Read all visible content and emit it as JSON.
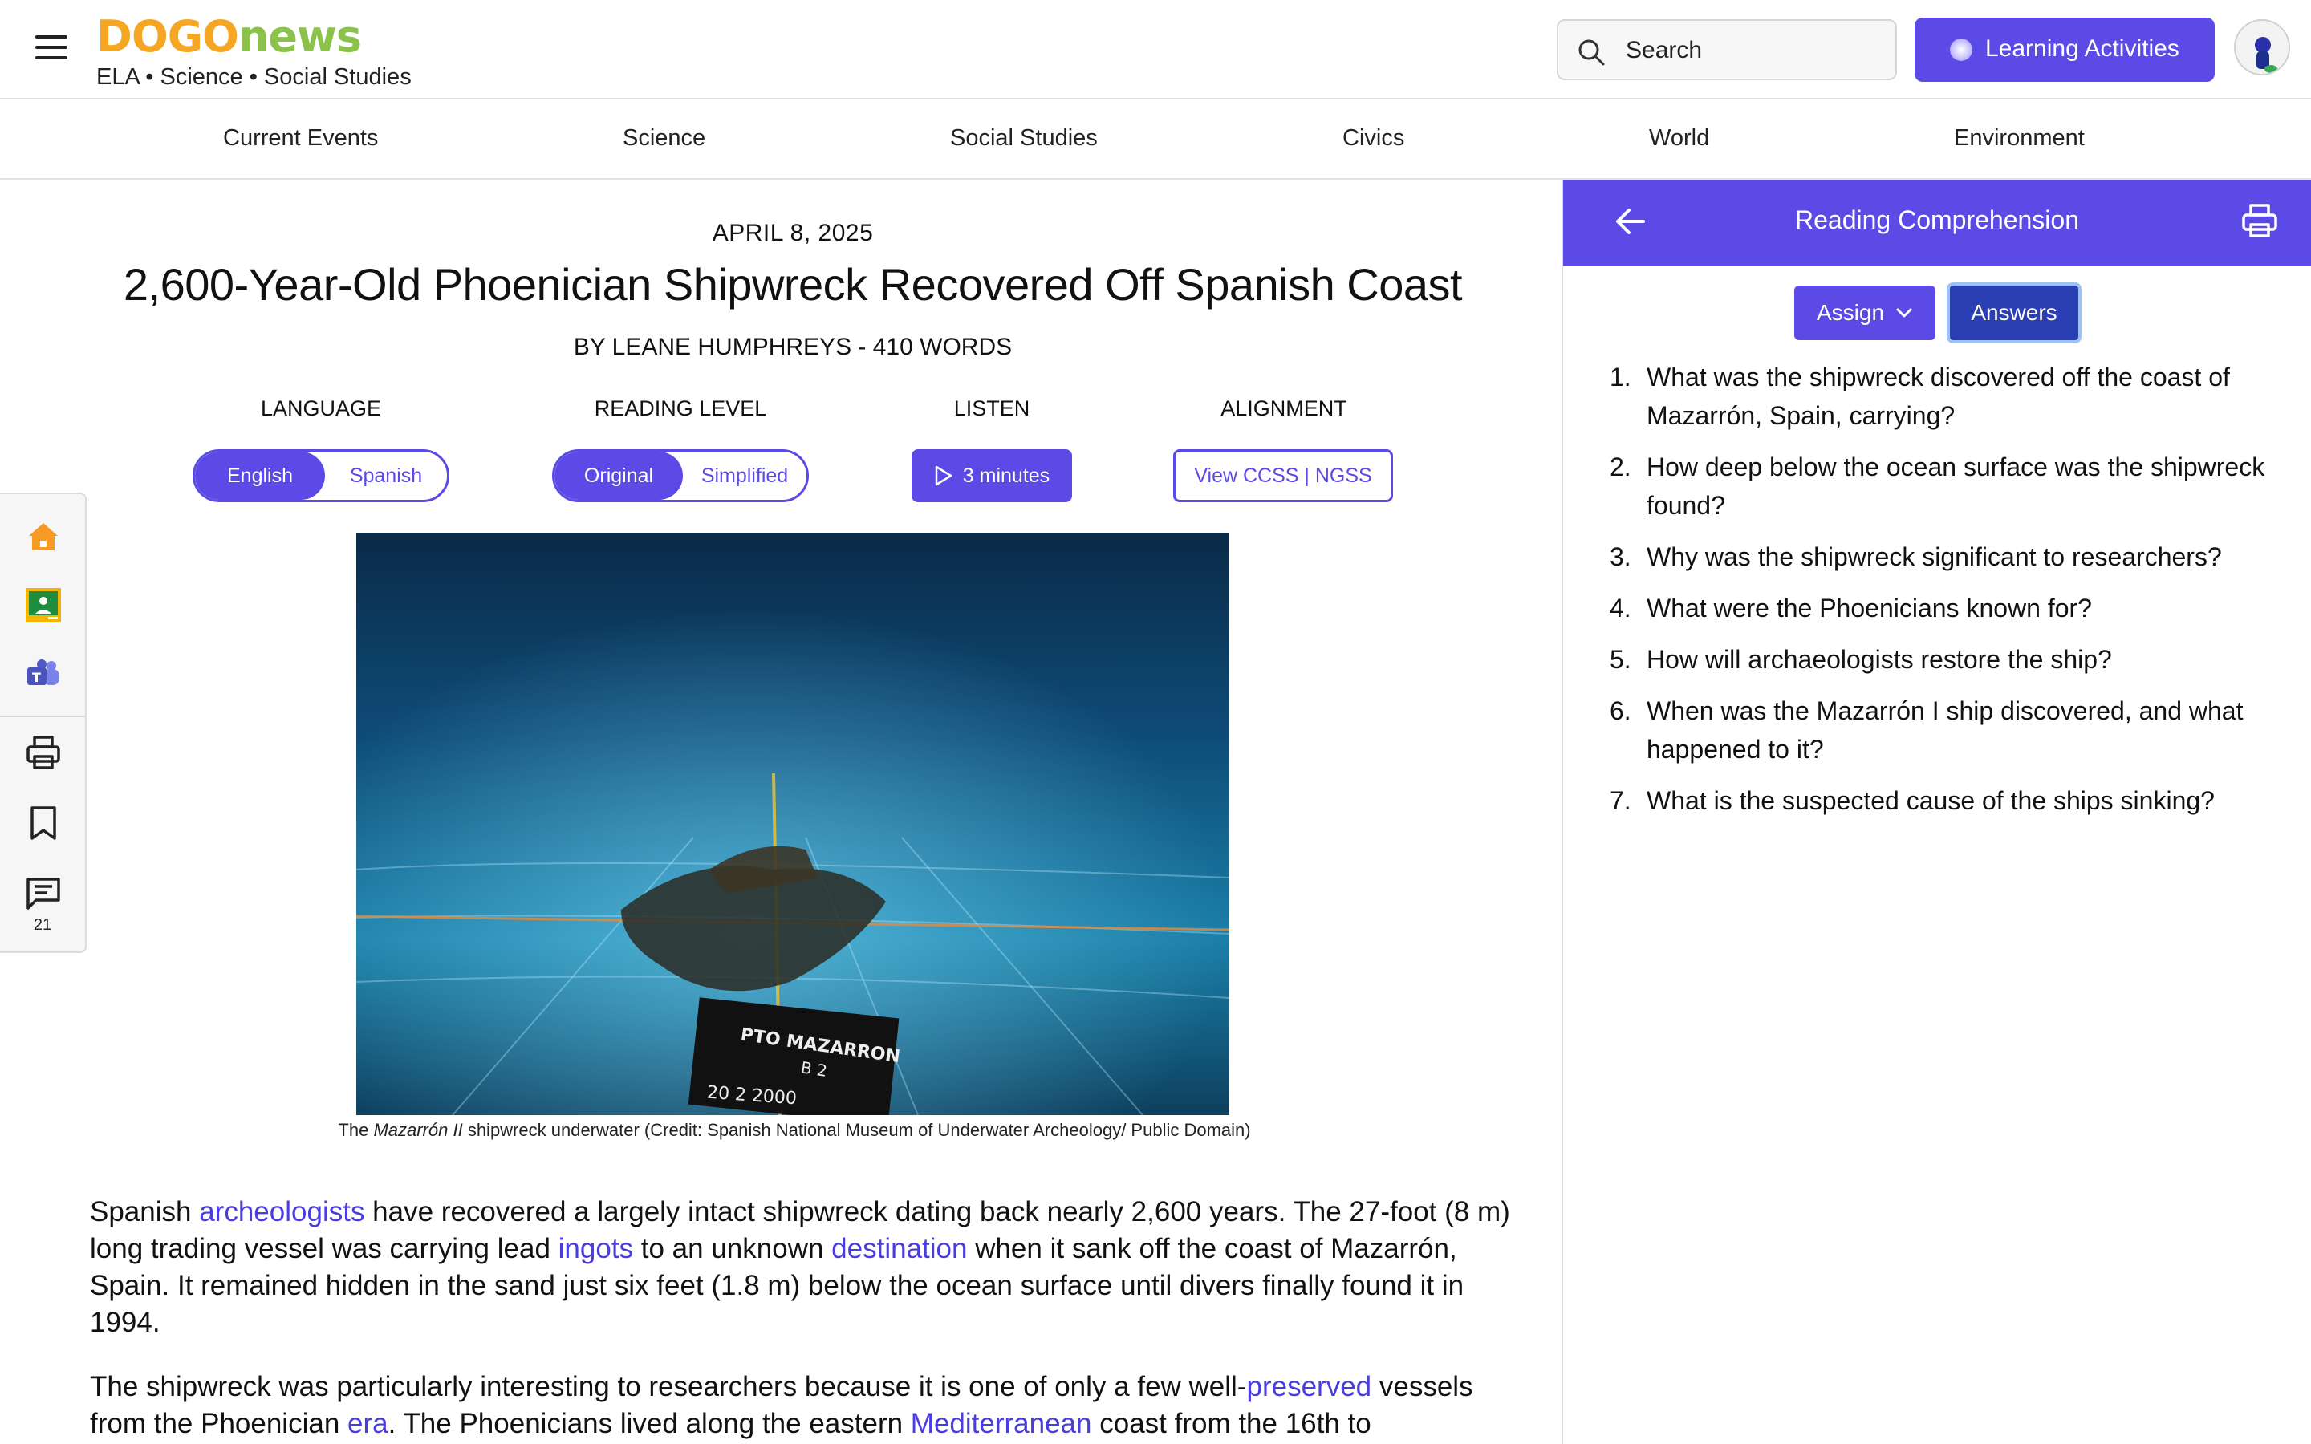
{
  "header": {
    "logo_part1": "DOGO",
    "logo_part2": "news",
    "tagline": "ELA • Science • Social Studies",
    "search_label": "Search",
    "learning_activities_label": "Learning Activities",
    "accent_color": "#5b4ae6"
  },
  "nav": {
    "items": [
      {
        "label": "Current Events"
      },
      {
        "label": "Science"
      },
      {
        "label": "Social Studies"
      },
      {
        "label": "Civics"
      },
      {
        "label": "World"
      },
      {
        "label": "Environment"
      }
    ]
  },
  "toolbar": {
    "tools": [
      "home-icon",
      "google-classroom-icon",
      "teams-icon",
      "print-icon",
      "bookmark-icon",
      "comment-icon"
    ],
    "comment_count": "21"
  },
  "article": {
    "date": "APRIL 8, 2025",
    "title": "2,600-Year-Old Phoenician Shipwreck Recovered Off Spanish Coast",
    "byline": "BY LEANE HUMPHREYS - 410 WORDS",
    "language_label": "LANGUAGE",
    "language_options": [
      "English",
      "Spanish"
    ],
    "language_selected": "English",
    "reading_level_label": "READING LEVEL",
    "reading_level_options": [
      "Original",
      "Simplified"
    ],
    "reading_level_selected": "Original",
    "listen_label": "LISTEN",
    "listen_button": "3 minutes",
    "alignment_label": "ALIGNMENT",
    "alignment_button": "View CCSS | NGSS",
    "image_sign_line1": "PTO MAZARRON",
    "image_sign_line2": "B 2",
    "image_sign_line3": "20 2 2000",
    "caption_pre": "The ",
    "caption_italic": "Mazarrón II",
    "caption_post": " shipwreck underwater (Credit: Spanish National Museum of Underwater Archeology/ Public Domain)",
    "p1": {
      "t1": "Spanish ",
      "l1": "archeologists",
      "t2": " have recovered a largely intact shipwreck dating back nearly 2,600 years. The 27-foot (8 m) long trading vessel was carrying lead ",
      "l2": "ingots",
      "t3": " to an unknown ",
      "l3": "destination",
      "t4": " when it sank off the coast of Mazarrón, Spain. It remained hidden in the sand just six feet (1.8 m) below the ocean surface until divers finally found it in 1994."
    },
    "p2": {
      "t1": "The shipwreck was particularly interesting to researchers because it is one of only a few well-",
      "l1": "preserved",
      "t2": " vessels from the Phoenician ",
      "l2": "era",
      "t3": ". The Phoenicians lived along the eastern ",
      "l3": "Mediterranean",
      "t4": " coast from the 16th to"
    }
  },
  "panel": {
    "title": "Reading Comprehension",
    "assign_label": "Assign",
    "answers_label": "Answers",
    "questions": [
      {
        "num": "1.",
        "text": "What was the shipwreck discovered off the coast of Mazarrón, Spain, carrying?"
      },
      {
        "num": "2.",
        "text": "How deep below the ocean surface was the shipwreck found?"
      },
      {
        "num": "3.",
        "text": "Why was the shipwreck significant to researchers?"
      },
      {
        "num": "4.",
        "text": "What were the Phoenicians known for?"
      },
      {
        "num": "5.",
        "text": "How will archaeologists restore the ship?"
      },
      {
        "num": "6.",
        "text": "When was the Mazarrón I ship discovered, and what happened to it?"
      },
      {
        "num": "7.",
        "text": "What is the suspected cause of the ships sinking?"
      }
    ]
  }
}
